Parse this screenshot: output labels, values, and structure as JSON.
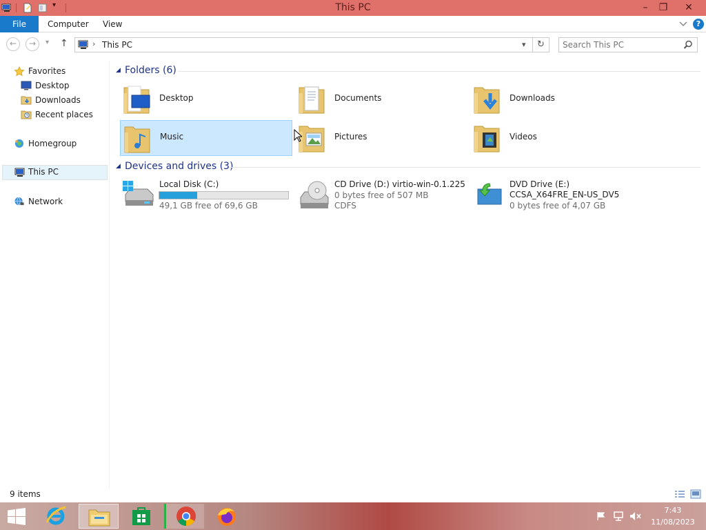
{
  "window": {
    "title": "This PC",
    "minimize": "–",
    "restore": "❐",
    "close": "✕"
  },
  "ribbon": {
    "tabs": [
      "File",
      "Computer",
      "View"
    ],
    "expand_icon": "chevron-down-icon",
    "help_icon": "help-icon",
    "help_glyph": "?"
  },
  "address": {
    "back_glyph": "←",
    "forward_glyph": "→",
    "recent_glyph": "▾",
    "up_glyph": "↑",
    "path": "This PC",
    "separator": "›",
    "dropdown_glyph": "▾",
    "refresh_glyph": "↻",
    "search_placeholder": "Search This PC"
  },
  "nav": {
    "favorites": {
      "label": "Favorites",
      "items": [
        "Desktop",
        "Downloads",
        "Recent places"
      ]
    },
    "homegroup": "Homegroup",
    "this_pc": "This PC",
    "network": "Network"
  },
  "folders_group": {
    "title": "Folders (6)",
    "items": [
      "Desktop",
      "Documents",
      "Downloads",
      "Music",
      "Pictures",
      "Videos"
    ]
  },
  "devices_group": {
    "title": "Devices and drives (3)",
    "drives": [
      {
        "name": "Local Disk (C:)",
        "detail": "49,1 GB free of 69,6 GB",
        "used_fraction": 0.295
      },
      {
        "name": "CD Drive (D:) virtio-win-0.1.225",
        "detail": "0 bytes free of 507 MB",
        "fs": "CDFS"
      },
      {
        "name": "DVD Drive (E:)",
        "label": "CCSA_X64FRE_EN-US_DV5",
        "detail": "0 bytes free of 4,07 GB"
      }
    ]
  },
  "status": {
    "count": "9 items"
  },
  "taskbar": {
    "time": "7:43",
    "date": "11/08/2023"
  },
  "colors": {
    "accent": "#1979ca",
    "titlebar": "#e0716a",
    "group_header": "#1e3287",
    "selection": "#cce8ff",
    "progress": "#26a0da"
  }
}
